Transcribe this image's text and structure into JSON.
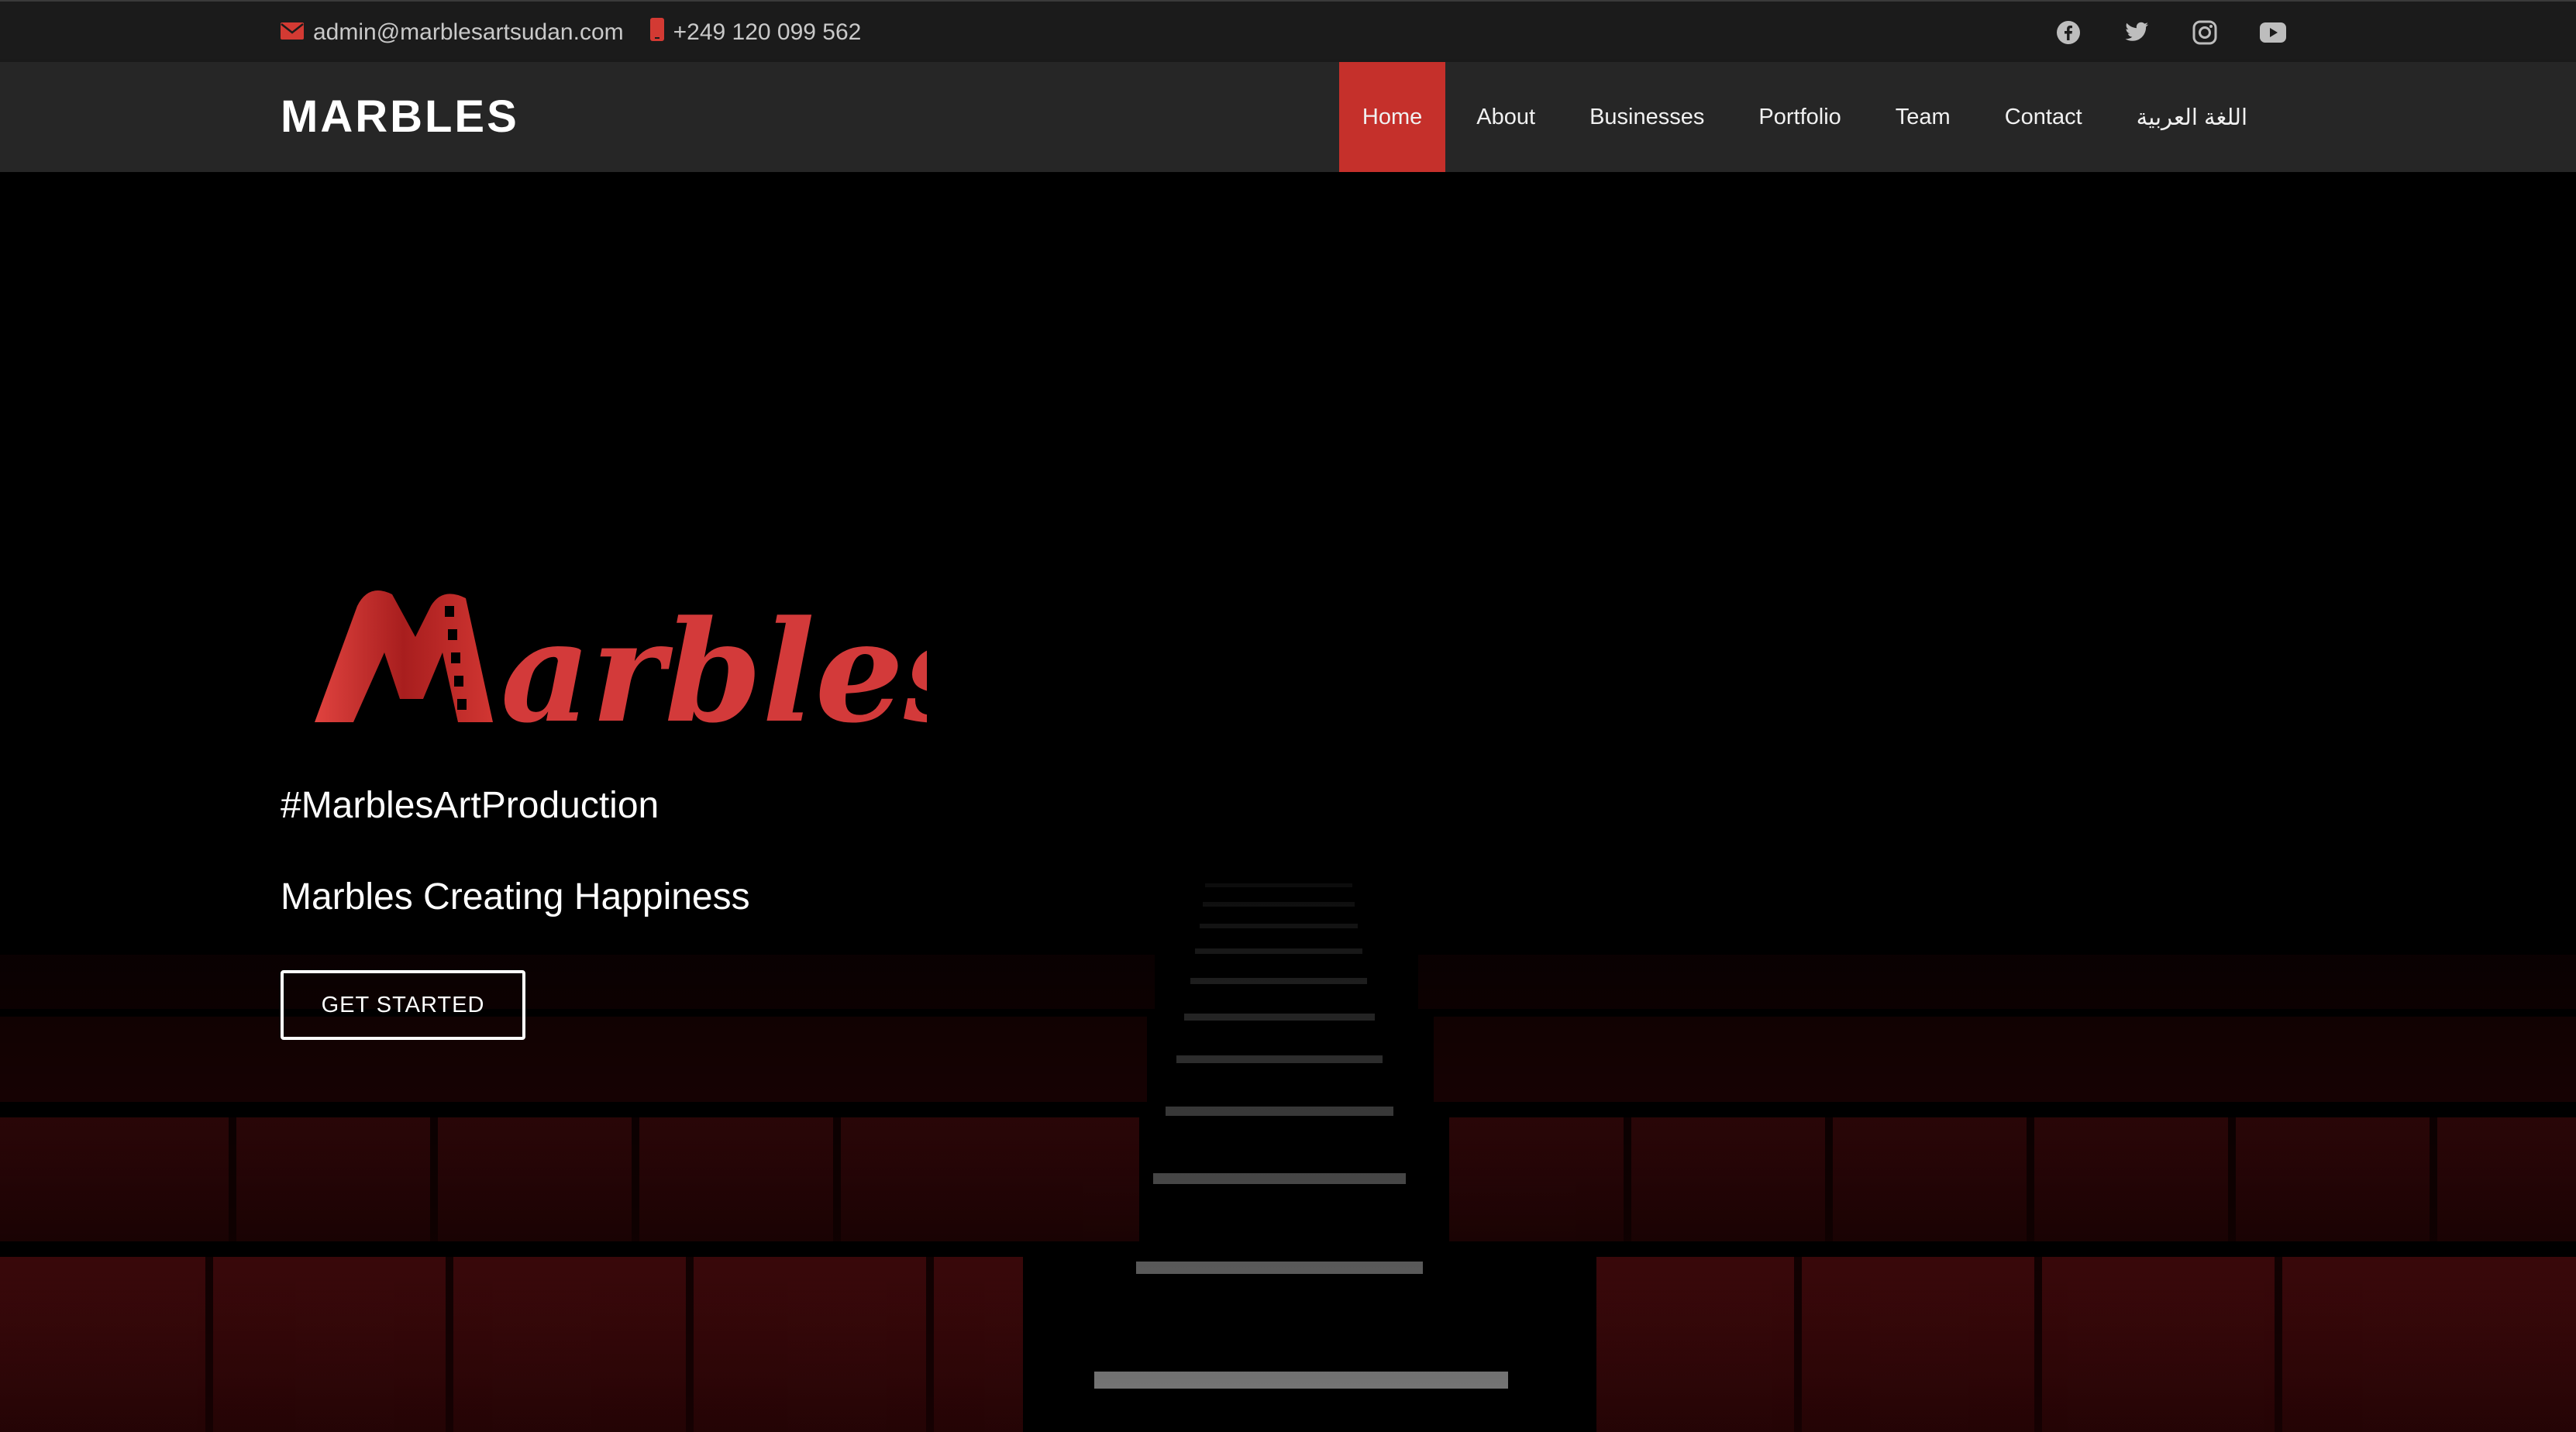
{
  "topbar": {
    "email": "admin@marblesartsudan.com",
    "phone": "+249 120 099 562",
    "email_icon": "envelope-icon",
    "phone_icon": "mobile-phone-icon",
    "social": [
      "facebook-icon",
      "twitter-icon",
      "instagram-icon",
      "youtube-icon"
    ]
  },
  "navbar": {
    "brand": "MARBLES",
    "items": [
      {
        "label": "Home",
        "active": true
      },
      {
        "label": "About"
      },
      {
        "label": "Businesses"
      },
      {
        "label": "Portfolio"
      },
      {
        "label": "Team"
      },
      {
        "label": "Contact"
      },
      {
        "label": "اللغة العربية"
      }
    ]
  },
  "hero": {
    "logo_text": "Marbles",
    "hashtag": "#MarblesArtProduction",
    "tagline": "Marbles Creating Happiness",
    "cta_label": "GET STARTED"
  },
  "colors": {
    "accent": "#c5302b",
    "topbar_bg": "#1b1b1b",
    "navbar_bg": "#262626",
    "seat_red": "#4a0a0c"
  }
}
